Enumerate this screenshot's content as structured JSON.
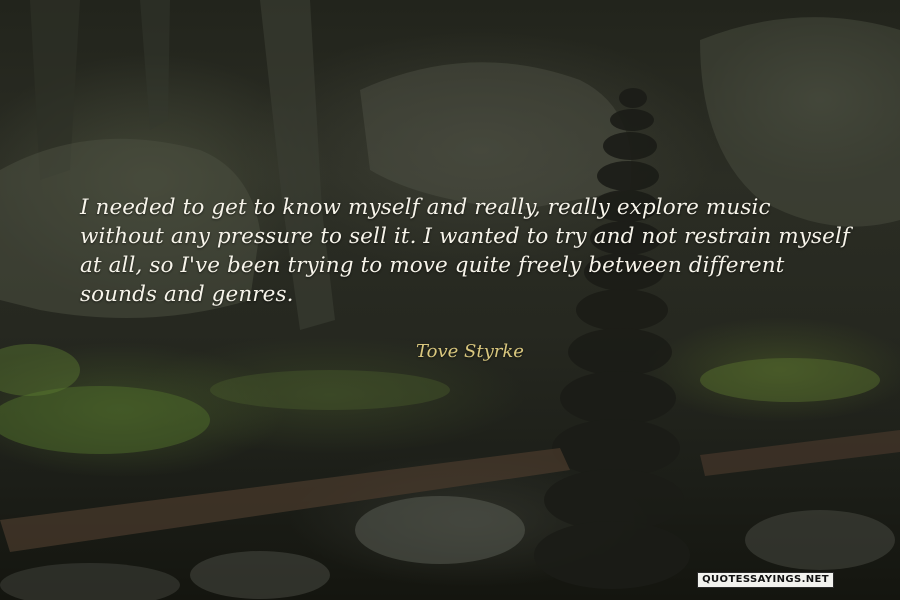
{
  "quote": {
    "text": "I needed to get to know myself and really, really explore music without any pressure to sell it. I wanted to try and not restrain myself at all, so I've been trying to move quite freely between different sounds and genres.",
    "author": "Tove Styrke"
  },
  "watermark": {
    "text": "QUOTESSAYINGS.NET"
  },
  "colors": {
    "quote_text": "#f7f4ea",
    "author_text": "#d9c77e",
    "background": "#22241c"
  }
}
